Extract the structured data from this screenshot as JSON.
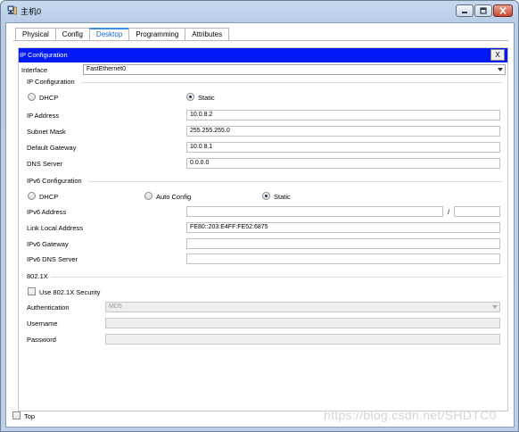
{
  "window": {
    "title": "主机0",
    "icon": "pc-icon",
    "controls": [
      "minimize-icon",
      "maximize-icon",
      "close-icon"
    ]
  },
  "tabs": [
    "Physical",
    "Config",
    "Desktop",
    "Programming",
    "Attributes"
  ],
  "active_tab": "Desktop",
  "panel": {
    "title": "IP Configuration",
    "close_label": "X",
    "interface_label": "Interface",
    "interface_value": "FastEthernet0"
  },
  "ipv4": {
    "section_label": "IP Configuration",
    "dhcp_label": "DHCP",
    "static_label": "Static",
    "mode": "Static",
    "fields": [
      {
        "label": "IP Address",
        "value": "10.0.8.2"
      },
      {
        "label": "Subnet Mask",
        "value": "255.255.255.0"
      },
      {
        "label": "Default Gateway",
        "value": "10.0.8.1"
      },
      {
        "label": "DNS Server",
        "value": "0.0.0.0"
      }
    ]
  },
  "ipv6": {
    "section_label": "IPv6 Configuration",
    "dhcp_label": "DHCP",
    "auto_label": "Auto Config",
    "static_label": "Static",
    "mode": "Static",
    "address_label": "IPv6 Address",
    "address_value": "",
    "prefix_separator": "/",
    "prefix_value": "",
    "link_local_label": "Link Local Address",
    "link_local_value": "FE80::203:E4FF:FE52:6875",
    "gateway_label": "IPv6 Gateway",
    "gateway_value": "",
    "dns_label": "IPv6 DNS Server",
    "dns_value": ""
  },
  "dot1x": {
    "section_label": "802.1X",
    "use_label": "Use 802.1X Security",
    "use_checked": false,
    "auth_label": "Authentication",
    "auth_value": "MD5",
    "username_label": "Username",
    "username_value": "",
    "password_label": "Password",
    "password_value": ""
  },
  "footer": {
    "top_label": "Top",
    "top_checked": false
  },
  "watermark": "https://blog.csdn.net/SHDTC0"
}
